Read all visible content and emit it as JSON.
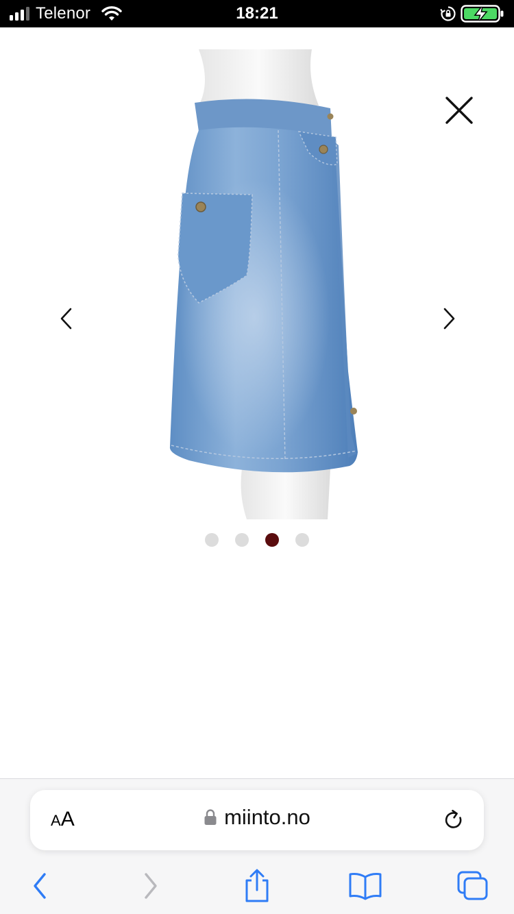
{
  "status_bar": {
    "carrier": "Telenor",
    "time": "18:21"
  },
  "viewer": {
    "image_alt": "Denim skirt side view",
    "total_images": 4,
    "active_index": 2
  },
  "browser": {
    "text_size_label_small": "A",
    "text_size_label_big": "A",
    "url": "miinto.no"
  },
  "colors": {
    "active_dot": "#5a0c0e",
    "inactive_dot": "#dcdcdc",
    "safari_blue": "#2f7cf6",
    "battery_green": "#4cd964"
  },
  "icons": {
    "close": "close-icon",
    "prev": "chevron-left-icon",
    "next": "chevron-right-icon",
    "reload": "reload-icon",
    "lock": "padlock-icon",
    "share": "share-icon",
    "bookmarks": "book-icon",
    "tabs": "tabs-icon"
  }
}
